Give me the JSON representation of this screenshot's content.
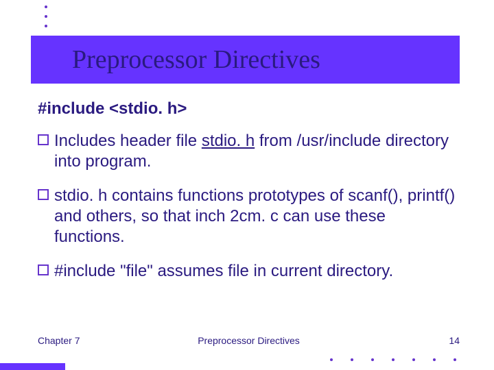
{
  "title": "Preprocessor Directives",
  "heading": "#include <stdio. h>",
  "bullets": {
    "b1_pre": "Includes header file ",
    "b1_underline": "stdio. h",
    "b1_post": " from /usr/include directory into program.",
    "b2": "stdio. h contains functions prototypes of scanf(), printf() and others, so that inch 2cm. c can use these functions.",
    "b3": "#include \"file\" assumes file in current directory."
  },
  "footer": {
    "left": "Chapter 7",
    "center": "Preprocessor Directives",
    "right": "14"
  }
}
